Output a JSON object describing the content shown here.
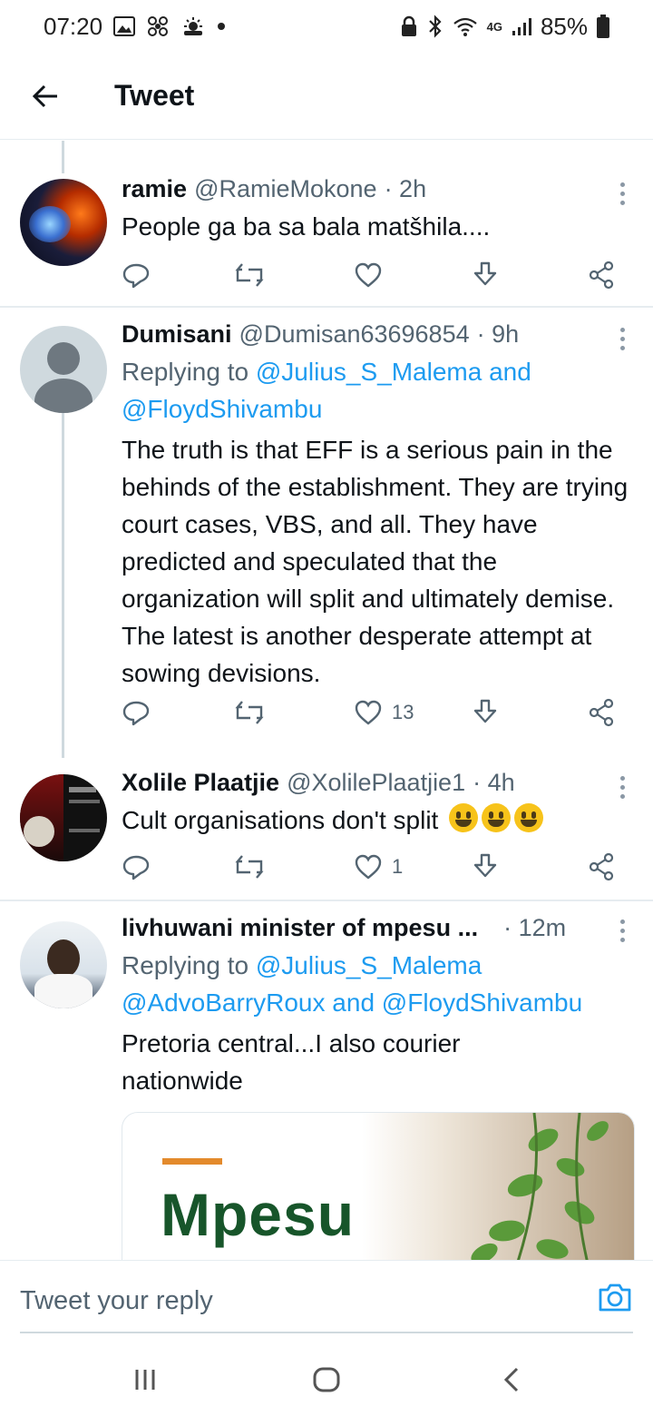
{
  "status_bar": {
    "time": "07:20",
    "left_icons": [
      "image-icon",
      "pinwheel-icon",
      "weather-icon",
      "dot-icon"
    ],
    "network": "4G",
    "battery": "85%"
  },
  "header": {
    "title": "Tweet"
  },
  "tweets": [
    {
      "name": "ramie",
      "handle": "@RamieMokone",
      "time": "· 2h",
      "text": "People ga ba sa bala matšhila....",
      "likes": ""
    },
    {
      "name": "Dumisani",
      "handle": "@Dumisan63696854",
      "time": "· 9h",
      "replying_prefix": "Replying to ",
      "replying_user1": "@Julius_S_Malema",
      "replying_and": " and",
      "replying_user2": "@FloydShivambu",
      "text": "The truth is that EFF is a serious pain in the behinds of the establishment. They are trying court cases, VBS, and all. They have predicted and speculated that the organization will split and ultimately demise. The latest is another desperate attempt at sowing devisions.",
      "likes": "13"
    },
    {
      "name": "Xolile Plaatjie",
      "handle": "@XolilePlaatjie1",
      "time": "· 4h",
      "text": "Cult organisations don't split",
      "likes": "1"
    },
    {
      "name": "livhuwani minister of mpesu ...",
      "handle": "",
      "time": "· 12m",
      "replying_prefix": "Replying to ",
      "replying_user1": "@Julius_S_Malema",
      "replying_user2": "@AdvoBarryRoux",
      "replying_and": " and ",
      "replying_user3": "@FloydShivambu",
      "text": "Pretoria central...I also courier nationwide",
      "media_text": "Mpesu"
    }
  ],
  "reply_bar": {
    "placeholder": "Tweet your reply"
  },
  "colors": {
    "link": "#1d9bf0",
    "secondary_text": "#536471",
    "divider": "#e6ecf0"
  }
}
